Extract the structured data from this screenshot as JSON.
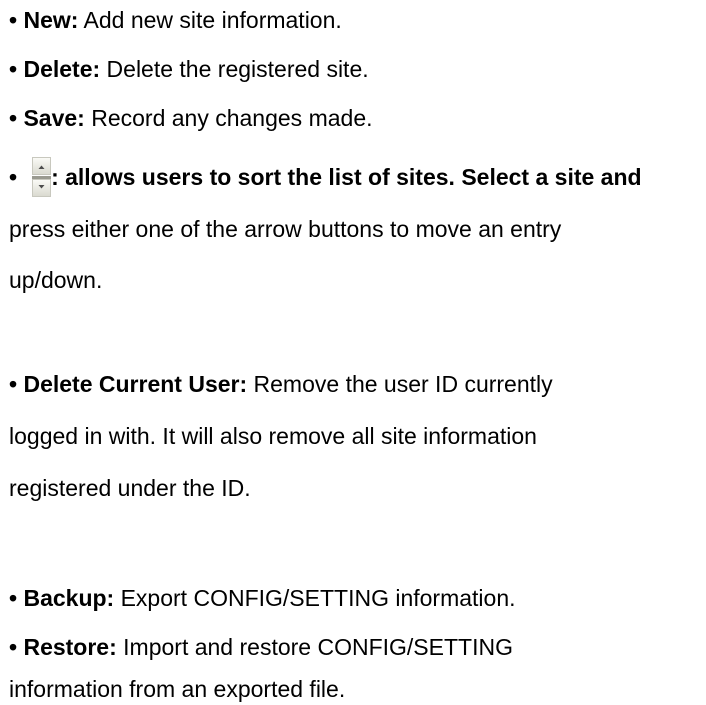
{
  "items": [
    {
      "bullet": "•",
      "label": "New:",
      "text": "Add new site information."
    },
    {
      "bullet": "•",
      "label": "Delete:",
      "text": "Delete the registered site."
    },
    {
      "bullet": "•",
      "label": "Save:",
      "text": "Record any changes made."
    }
  ],
  "sort": {
    "bullet": "•",
    "icon": "sort-arrows-icon",
    "line1": ": allows users to sort the list of sites. Select a site and",
    "line2": "press either one of the arrow buttons to move an entry",
    "line3": "up/down."
  },
  "delete_user": {
    "bullet": "•",
    "label": "Delete Current User:",
    "line1": "Remove the user ID currently",
    "line2": "logged in with. It will also remove all site information",
    "line3": "registered under the ID."
  },
  "backup": {
    "bullet": "•",
    "label": "Backup:",
    "text": "Export CONFIG/SETTING information."
  },
  "restore": {
    "bullet": "•",
    "label": "Restore:",
    "line1": "Import and restore CONFIG/SETTING",
    "line2": "information from an exported file."
  }
}
